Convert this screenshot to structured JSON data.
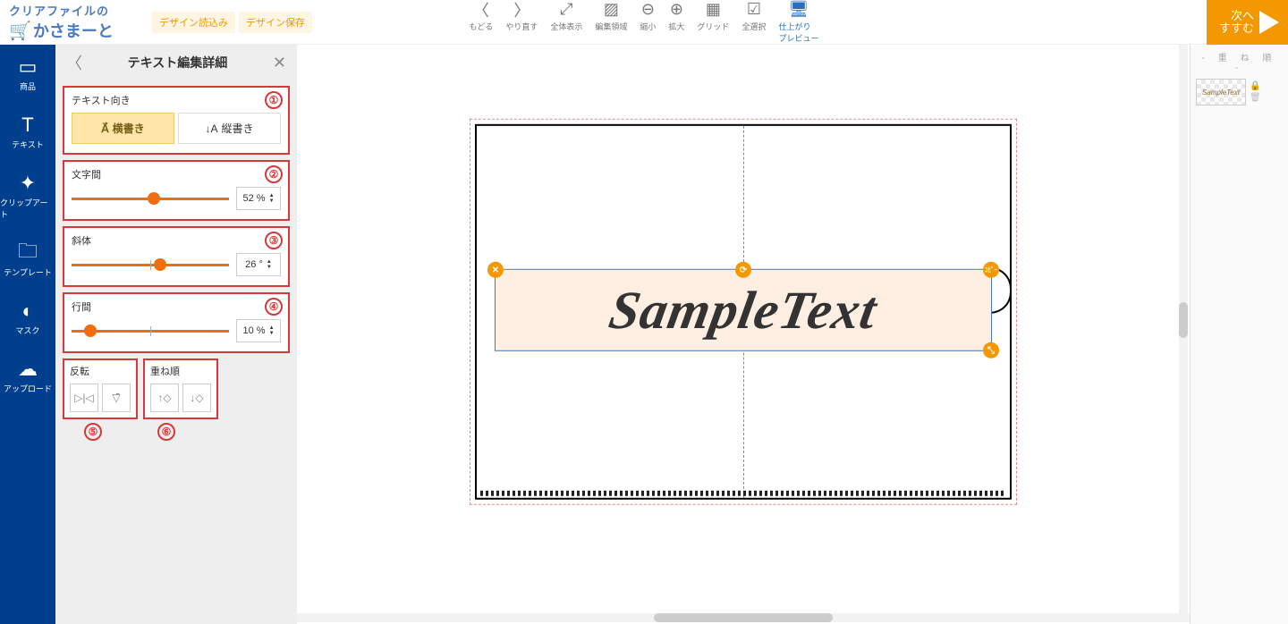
{
  "logo": {
    "top": "クリアファイルの",
    "main": "かさまーと"
  },
  "design_buttons": {
    "load": "デザイン読込み",
    "save": "デザイン保存"
  },
  "toolbar": {
    "undo": "もどる",
    "redo": "やり直す",
    "fullview": "全体表示",
    "editarea": "編集領域",
    "zoomout": "縮小",
    "zoomin": "拡大",
    "grid": "グリッド",
    "selectall": "全選択",
    "preview": "仕上がり\nプレビュー"
  },
  "next": {
    "line1": "次へ",
    "line2": "すすむ"
  },
  "nav": {
    "product": "商品",
    "text": "テキスト",
    "clipart": "クリップアート",
    "template": "テンプレート",
    "mask": "マスク",
    "upload": "アップロード"
  },
  "panel": {
    "title": "テキスト編集詳細",
    "orientation": {
      "label": "テキスト向き",
      "horizontal": "横書き",
      "vertical": "縦書き",
      "badge": "①"
    },
    "spacing": {
      "label": "文字間",
      "value": "52 %",
      "badge": "②",
      "thumb_pct": 52
    },
    "italic": {
      "label": "斜体",
      "value": "26 °",
      "badge": "③",
      "thumb_pct": 56
    },
    "leading": {
      "label": "行間",
      "value": "10 %",
      "badge": "④",
      "thumb_pct": 12
    },
    "flip": {
      "label": "反転",
      "badge": "⑤"
    },
    "order": {
      "label": "重ね順",
      "badge": "⑥"
    }
  },
  "canvas": {
    "sample_text": "SampleText"
  },
  "layers": {
    "header": "- 重 ね 順 -",
    "item": "SampleText"
  }
}
